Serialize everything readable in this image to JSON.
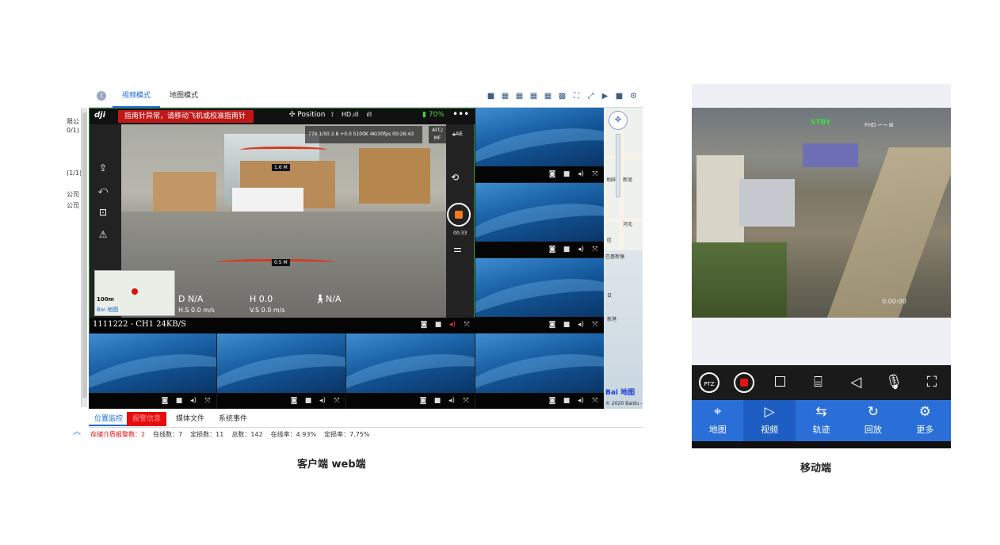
{
  "web": {
    "caption": "客户端 web端",
    "left_strip": [
      "限公",
      "0/1)",
      "(1/1)",
      "公司",
      "公司"
    ],
    "tabs": [
      {
        "label": "视频模式",
        "active": true
      },
      {
        "label": "地图模式",
        "active": false
      }
    ],
    "layout_icons": [
      "layout-1",
      "layout-4",
      "layout-6",
      "layout-8",
      "layout-9",
      "layout-16",
      "fullscreen-fit",
      "fullscreen-expand",
      "play",
      "stop",
      "settings"
    ],
    "main_video": {
      "logo": "dji",
      "warning": "指南针异常，请移动飞机或校准指南针",
      "mode": "Position",
      "status_items": [
        "HD.ıll",
        "ıll"
      ],
      "battery": "70%",
      "camera_info": "770  1/50  2.8  +0.0  5100K   4K/30fps 00:26:43",
      "afmf": "AFC/ MF",
      "ae": "AE",
      "range_top": "1.6 M",
      "range_bottom": "0.5 M",
      "rec_time": "00:33",
      "minimap_scale": "100m",
      "minimap_logo": "Bai 地图",
      "telemetry": {
        "d": "D N/A",
        "h": "H 0.0",
        "home": "N/A",
        "hs": "H.S 0.0 m/s",
        "vs": "V.S 0.0 m/s"
      },
      "caption": "1111222 - CH1 24KB/S"
    },
    "map": {
      "labels": [
        "地辟",
        "新旭",
        "河北",
        "区",
        "巴基新塘",
        "新港",
        "日"
      ],
      "brand": "Bai 地图",
      "copyright": "© 2020 Baidu -"
    },
    "bottom_tabs": [
      {
        "label": "位置监控",
        "active": true
      },
      {
        "label": "报警信息",
        "alarm": true
      },
      {
        "label": "媒体文件"
      },
      {
        "label": "系统事件"
      }
    ],
    "status": {
      "storage_alarm": "存储介质报警数：2",
      "online": "在线数：7",
      "located": "定损数：11",
      "total": "总数：142",
      "online_rate": "在线率：4.93%",
      "located_rate": "定损率：7.75%"
    }
  },
  "mobile": {
    "caption": "移动端",
    "overlay": {
      "stby": "STBY",
      "fhd": "FHD",
      "time": "0:00:00"
    },
    "controls": [
      "PTZ",
      "record",
      "stop",
      "camera",
      "speaker",
      "microphone",
      "fullscreen"
    ],
    "nav": [
      {
        "label": "地图",
        "icon": "map-pin-icon"
      },
      {
        "label": "视频",
        "icon": "video-icon",
        "active": true
      },
      {
        "label": "轨迹",
        "icon": "track-icon"
      },
      {
        "label": "回放",
        "icon": "playback-icon"
      },
      {
        "label": "更多",
        "icon": "gear-icon"
      }
    ]
  },
  "colors": {
    "accent": "#1b6ad6",
    "alarm": "#e50d0d",
    "mobile_nav": "#2a6fd8",
    "dji_warning": "#c01818",
    "battery": "#49d14f"
  }
}
